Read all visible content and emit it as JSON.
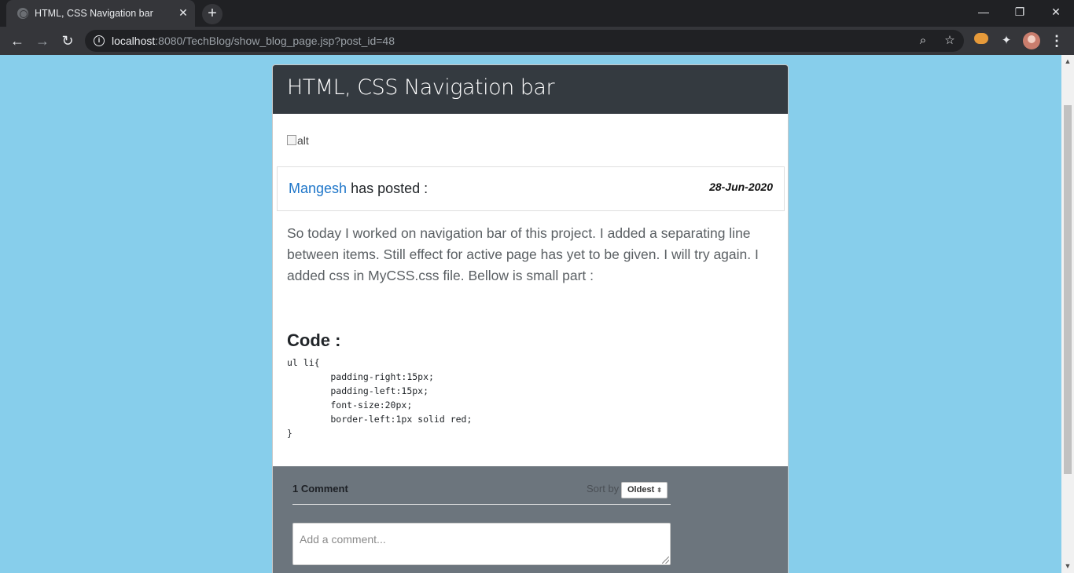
{
  "browser": {
    "tab_title": "HTML, CSS Navigation bar",
    "tab_close": "✕",
    "new_tab": "+",
    "url_host": "localhost",
    "url_rest": ":8080/TechBlog/show_blog_page.jsp?post_id=48",
    "window_controls": {
      "minimize": "—",
      "maximize": "❐",
      "close": "✕"
    },
    "nav": {
      "back": "←",
      "forward": "→",
      "reload": "↻"
    },
    "icons": {
      "info": "i",
      "zoom": "⌕",
      "star": "☆",
      "puzzle": "✦",
      "menu": "⋮"
    }
  },
  "post": {
    "title": "HTML, CSS Navigation bar",
    "image_alt": "alt",
    "author": "Mangesh",
    "posted_text": " has posted :",
    "date": "28-Jun-2020",
    "body": "So today I worked on navigation bar of this project. I added a separating line between items. Still effect for active page has yet to be given. I will try again. I added css in MyCSS.css file. Bellow is small part :",
    "code_heading": "Code :",
    "code": "ul li{\n        padding-right:15px;\n        padding-left:15px;\n        font-size:20px;\n        border-left:1px solid red;\n}"
  },
  "comments": {
    "count_label": "1 Comment",
    "sort_label": "Sort by",
    "sort_value": "Oldest",
    "input_placeholder": "Add a comment..."
  },
  "colors": {
    "page_background": "#87ceeb",
    "card_header": "#343a40",
    "author_link": "#1e76c9",
    "comments_background": "#6c757d"
  }
}
